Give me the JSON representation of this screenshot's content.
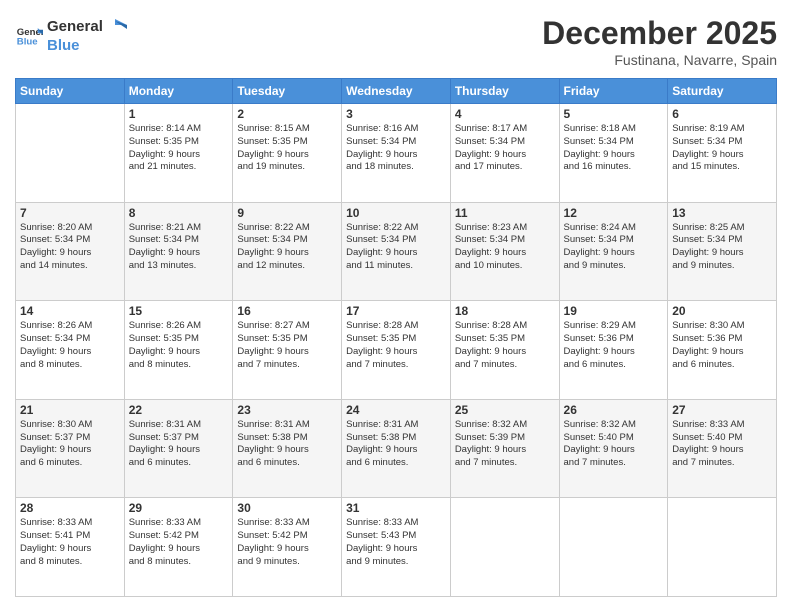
{
  "header": {
    "logo_general": "General",
    "logo_blue": "Blue",
    "month": "December 2025",
    "location": "Fustinana, Navarre, Spain"
  },
  "days_of_week": [
    "Sunday",
    "Monday",
    "Tuesday",
    "Wednesday",
    "Thursday",
    "Friday",
    "Saturday"
  ],
  "weeks": [
    [
      {
        "day": "",
        "lines": []
      },
      {
        "day": "1",
        "lines": [
          "Sunrise: 8:14 AM",
          "Sunset: 5:35 PM",
          "Daylight: 9 hours",
          "and 21 minutes."
        ]
      },
      {
        "day": "2",
        "lines": [
          "Sunrise: 8:15 AM",
          "Sunset: 5:35 PM",
          "Daylight: 9 hours",
          "and 19 minutes."
        ]
      },
      {
        "day": "3",
        "lines": [
          "Sunrise: 8:16 AM",
          "Sunset: 5:34 PM",
          "Daylight: 9 hours",
          "and 18 minutes."
        ]
      },
      {
        "day": "4",
        "lines": [
          "Sunrise: 8:17 AM",
          "Sunset: 5:34 PM",
          "Daylight: 9 hours",
          "and 17 minutes."
        ]
      },
      {
        "day": "5",
        "lines": [
          "Sunrise: 8:18 AM",
          "Sunset: 5:34 PM",
          "Daylight: 9 hours",
          "and 16 minutes."
        ]
      },
      {
        "day": "6",
        "lines": [
          "Sunrise: 8:19 AM",
          "Sunset: 5:34 PM",
          "Daylight: 9 hours",
          "and 15 minutes."
        ]
      }
    ],
    [
      {
        "day": "7",
        "lines": [
          "Sunrise: 8:20 AM",
          "Sunset: 5:34 PM",
          "Daylight: 9 hours",
          "and 14 minutes."
        ]
      },
      {
        "day": "8",
        "lines": [
          "Sunrise: 8:21 AM",
          "Sunset: 5:34 PM",
          "Daylight: 9 hours",
          "and 13 minutes."
        ]
      },
      {
        "day": "9",
        "lines": [
          "Sunrise: 8:22 AM",
          "Sunset: 5:34 PM",
          "Daylight: 9 hours",
          "and 12 minutes."
        ]
      },
      {
        "day": "10",
        "lines": [
          "Sunrise: 8:22 AM",
          "Sunset: 5:34 PM",
          "Daylight: 9 hours",
          "and 11 minutes."
        ]
      },
      {
        "day": "11",
        "lines": [
          "Sunrise: 8:23 AM",
          "Sunset: 5:34 PM",
          "Daylight: 9 hours",
          "and 10 minutes."
        ]
      },
      {
        "day": "12",
        "lines": [
          "Sunrise: 8:24 AM",
          "Sunset: 5:34 PM",
          "Daylight: 9 hours",
          "and 9 minutes."
        ]
      },
      {
        "day": "13",
        "lines": [
          "Sunrise: 8:25 AM",
          "Sunset: 5:34 PM",
          "Daylight: 9 hours",
          "and 9 minutes."
        ]
      }
    ],
    [
      {
        "day": "14",
        "lines": [
          "Sunrise: 8:26 AM",
          "Sunset: 5:34 PM",
          "Daylight: 9 hours",
          "and 8 minutes."
        ]
      },
      {
        "day": "15",
        "lines": [
          "Sunrise: 8:26 AM",
          "Sunset: 5:35 PM",
          "Daylight: 9 hours",
          "and 8 minutes."
        ]
      },
      {
        "day": "16",
        "lines": [
          "Sunrise: 8:27 AM",
          "Sunset: 5:35 PM",
          "Daylight: 9 hours",
          "and 7 minutes."
        ]
      },
      {
        "day": "17",
        "lines": [
          "Sunrise: 8:28 AM",
          "Sunset: 5:35 PM",
          "Daylight: 9 hours",
          "and 7 minutes."
        ]
      },
      {
        "day": "18",
        "lines": [
          "Sunrise: 8:28 AM",
          "Sunset: 5:35 PM",
          "Daylight: 9 hours",
          "and 7 minutes."
        ]
      },
      {
        "day": "19",
        "lines": [
          "Sunrise: 8:29 AM",
          "Sunset: 5:36 PM",
          "Daylight: 9 hours",
          "and 6 minutes."
        ]
      },
      {
        "day": "20",
        "lines": [
          "Sunrise: 8:30 AM",
          "Sunset: 5:36 PM",
          "Daylight: 9 hours",
          "and 6 minutes."
        ]
      }
    ],
    [
      {
        "day": "21",
        "lines": [
          "Sunrise: 8:30 AM",
          "Sunset: 5:37 PM",
          "Daylight: 9 hours",
          "and 6 minutes."
        ]
      },
      {
        "day": "22",
        "lines": [
          "Sunrise: 8:31 AM",
          "Sunset: 5:37 PM",
          "Daylight: 9 hours",
          "and 6 minutes."
        ]
      },
      {
        "day": "23",
        "lines": [
          "Sunrise: 8:31 AM",
          "Sunset: 5:38 PM",
          "Daylight: 9 hours",
          "and 6 minutes."
        ]
      },
      {
        "day": "24",
        "lines": [
          "Sunrise: 8:31 AM",
          "Sunset: 5:38 PM",
          "Daylight: 9 hours",
          "and 6 minutes."
        ]
      },
      {
        "day": "25",
        "lines": [
          "Sunrise: 8:32 AM",
          "Sunset: 5:39 PM",
          "Daylight: 9 hours",
          "and 7 minutes."
        ]
      },
      {
        "day": "26",
        "lines": [
          "Sunrise: 8:32 AM",
          "Sunset: 5:40 PM",
          "Daylight: 9 hours",
          "and 7 minutes."
        ]
      },
      {
        "day": "27",
        "lines": [
          "Sunrise: 8:33 AM",
          "Sunset: 5:40 PM",
          "Daylight: 9 hours",
          "and 7 minutes."
        ]
      }
    ],
    [
      {
        "day": "28",
        "lines": [
          "Sunrise: 8:33 AM",
          "Sunset: 5:41 PM",
          "Daylight: 9 hours",
          "and 8 minutes."
        ]
      },
      {
        "day": "29",
        "lines": [
          "Sunrise: 8:33 AM",
          "Sunset: 5:42 PM",
          "Daylight: 9 hours",
          "and 8 minutes."
        ]
      },
      {
        "day": "30",
        "lines": [
          "Sunrise: 8:33 AM",
          "Sunset: 5:42 PM",
          "Daylight: 9 hours",
          "and 9 minutes."
        ]
      },
      {
        "day": "31",
        "lines": [
          "Sunrise: 8:33 AM",
          "Sunset: 5:43 PM",
          "Daylight: 9 hours",
          "and 9 minutes."
        ]
      },
      {
        "day": "",
        "lines": []
      },
      {
        "day": "",
        "lines": []
      },
      {
        "day": "",
        "lines": []
      }
    ]
  ]
}
